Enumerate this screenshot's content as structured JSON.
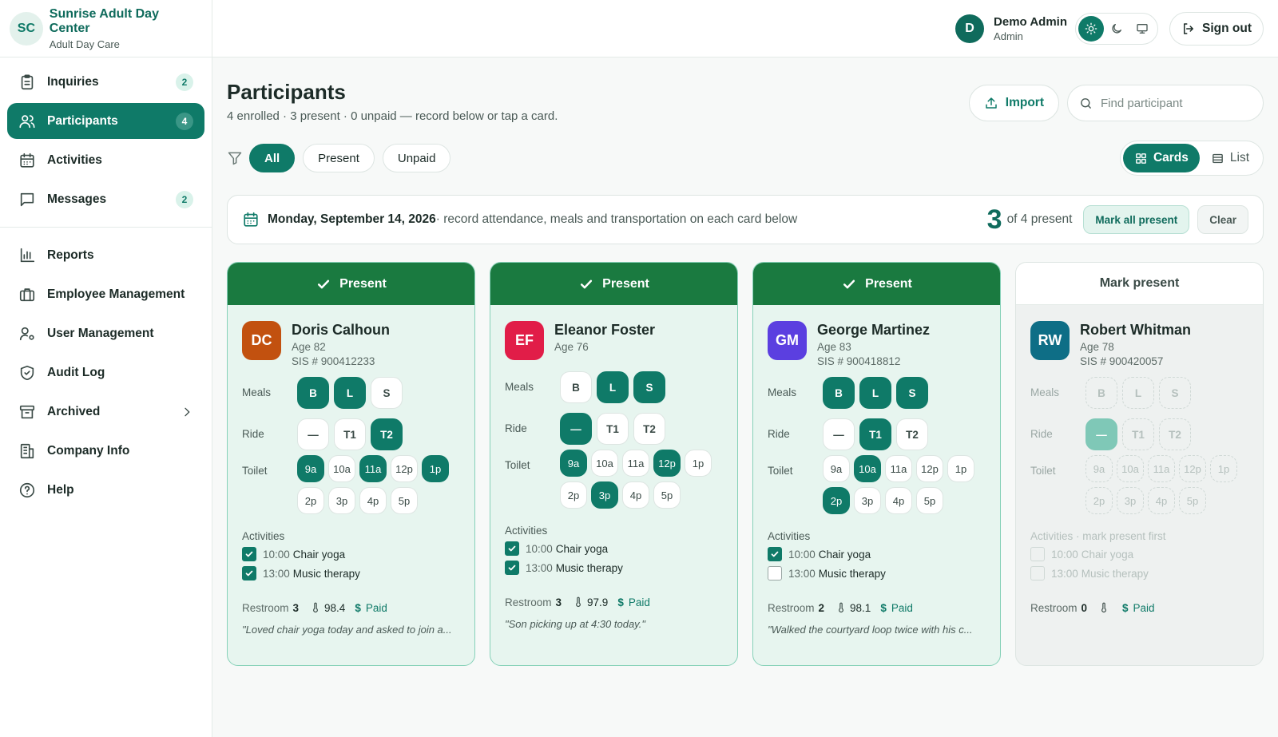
{
  "brand": {
    "initials": "SC",
    "name": "Sunrise Adult Day Center",
    "sub": "Adult Day Care"
  },
  "nav": {
    "primary": [
      {
        "label": "Inquiries",
        "badge": "2",
        "icon": "clipboard-icon"
      },
      {
        "label": "Participants",
        "badge": "4",
        "icon": "users-icon",
        "active": true
      },
      {
        "label": "Activities",
        "badge": "",
        "icon": "calendar-icon"
      },
      {
        "label": "Messages",
        "badge": "2",
        "icon": "message-icon"
      }
    ],
    "secondary": [
      {
        "label": "Reports",
        "icon": "bar-chart-icon"
      },
      {
        "label": "Employee Management",
        "icon": "briefcase-icon"
      },
      {
        "label": "User Management",
        "icon": "user-gear-icon"
      },
      {
        "label": "Audit Log",
        "icon": "shield-check-icon"
      },
      {
        "label": "Archived",
        "icon": "archive-icon"
      },
      {
        "label": "Company Info",
        "icon": "building-icon"
      },
      {
        "label": "Help",
        "icon": "help-circle-icon"
      }
    ]
  },
  "topbar": {
    "user_initial": "D",
    "user_name": "Demo Admin",
    "user_role": "Admin",
    "sign_out": "Sign out",
    "theme_selected": "light"
  },
  "page": {
    "title": "Participants",
    "subtitle": "4 enrolled · 3 present · 0 unpaid — record below or tap a card.",
    "import_label": "Import",
    "search_placeholder": "Find participant"
  },
  "filters": {
    "items": [
      "All",
      "Present",
      "Unpaid"
    ],
    "active": "All"
  },
  "view": {
    "cards": "Cards",
    "list": "List",
    "active": "Cards"
  },
  "day": {
    "date": "Monday, September 14, 2026",
    "desc": " · record attendance, meals and transportation on each card below",
    "present_count": "3",
    "of_text": "of 4 present",
    "mark_all": "Mark all present",
    "clear": "Clear"
  },
  "labels": {
    "meals": "Meals",
    "ride": "Ride",
    "toilet": "Toilet",
    "activities": "Activities",
    "restroom": "Restroom",
    "paid": "Paid",
    "present": "Present",
    "mark_present": "Mark present"
  },
  "colors": {
    "accent": "#0f7a68",
    "present_header": "#1a7a40"
  },
  "participants": [
    {
      "initials": "DC",
      "name": "Doris Calhoun",
      "age": "Age 82",
      "sis": "SIS # 900412233",
      "avatar_color": "#c2510f",
      "present": true,
      "meals": {
        "B": true,
        "L": true,
        "S": false
      },
      "ride": {
        "—": false,
        "T1": false,
        "T2": true
      },
      "toilet": [
        "9a",
        "11a",
        "1p"
      ],
      "activities_header": "Activities",
      "activities": [
        {
          "time": "10:00",
          "name": "Chair yoga",
          "done": true
        },
        {
          "time": "13:00",
          "name": "Music therapy",
          "done": true
        }
      ],
      "restroom": "3",
      "temp": "98.4",
      "note": "\"Loved chair yoga today and asked to join a..."
    },
    {
      "initials": "EF",
      "name": "Eleanor Foster",
      "age": "Age 76",
      "sis": "",
      "avatar_color": "#e11d48",
      "present": true,
      "meals": {
        "B": false,
        "L": true,
        "S": true
      },
      "ride": {
        "—": true,
        "T1": false,
        "T2": false
      },
      "toilet": [
        "9a",
        "12p",
        "3p"
      ],
      "activities_header": "Activities",
      "activities": [
        {
          "time": "10:00",
          "name": "Chair yoga",
          "done": true
        },
        {
          "time": "13:00",
          "name": "Music therapy",
          "done": true
        }
      ],
      "restroom": "3",
      "temp": "97.9",
      "note": "\"Son picking up at 4:30 today.\""
    },
    {
      "initials": "GM",
      "name": "George Martinez",
      "age": "Age 83",
      "sis": "SIS # 900418812",
      "avatar_color": "#5b3fe0",
      "present": true,
      "meals": {
        "B": true,
        "L": true,
        "S": true
      },
      "ride": {
        "—": false,
        "T1": true,
        "T2": false
      },
      "toilet": [
        "10a",
        "2p"
      ],
      "activities_header": "Activities",
      "activities": [
        {
          "time": "10:00",
          "name": "Chair yoga",
          "done": true
        },
        {
          "time": "13:00",
          "name": "Music therapy",
          "done": false
        }
      ],
      "restroom": "2",
      "temp": "98.1",
      "note": "\"Walked the courtyard loop twice with his c..."
    },
    {
      "initials": "RW",
      "name": "Robert Whitman",
      "age": "Age 78",
      "sis": "SIS # 900420057",
      "avatar_color": "#0e6e86",
      "present": false,
      "meals": {
        "B": false,
        "L": false,
        "S": false
      },
      "ride": {
        "—": true,
        "T1": false,
        "T2": false
      },
      "toilet": [],
      "activities_header": "Activities · mark present first",
      "activities": [
        {
          "time": "10:00",
          "name": "Chair yoga",
          "done": false
        },
        {
          "time": "13:00",
          "name": "Music therapy",
          "done": false
        }
      ],
      "restroom": "0",
      "temp": "",
      "note": ""
    }
  ],
  "toilet_slots": [
    "9a",
    "10a",
    "11a",
    "12p",
    "1p",
    "2p",
    "3p",
    "4p",
    "5p"
  ]
}
